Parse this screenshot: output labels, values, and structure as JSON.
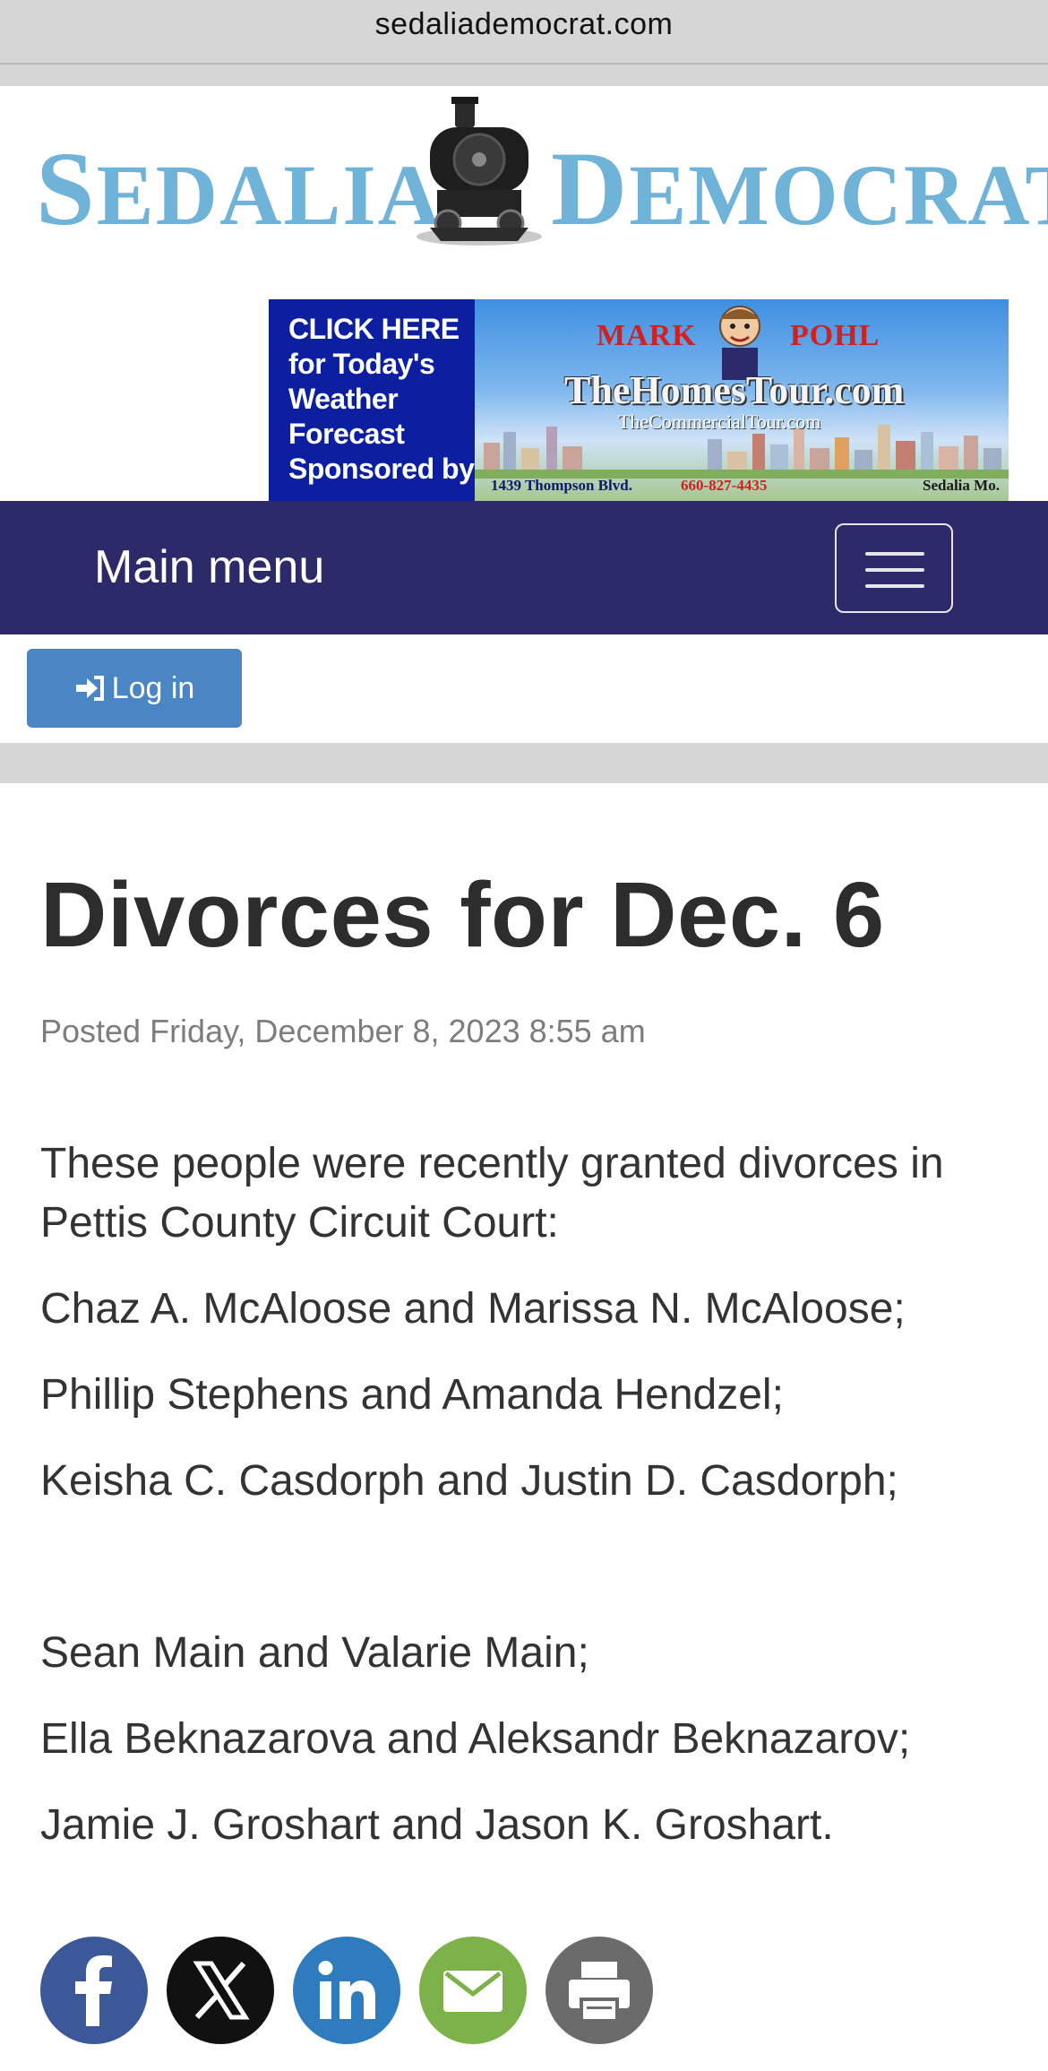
{
  "browser": {
    "url": "sedaliademocrat.com"
  },
  "masthead": {
    "logo_left": "Sedalia",
    "logo_right": "Democrat"
  },
  "ad": {
    "left_lines": [
      "CLICK HERE",
      "for Today's",
      "Weather",
      "Forecast",
      "Sponsored by"
    ],
    "name_first": "MARK",
    "name_last": "POHL",
    "site": "TheHomesTour.com",
    "sub_site": "TheCommercialTour.com",
    "address": "1439 Thompson Blvd.",
    "phone": "660-827-4435",
    "city": "Sedalia Mo."
  },
  "nav": {
    "title": "Main menu",
    "toggle_icon": "hamburger-icon"
  },
  "login": {
    "label": "Log in",
    "icon": "sign-in-icon"
  },
  "article": {
    "headline": "Divorces for Dec. 6",
    "posted": "Posted Friday, December 8, 2023 8:55 am",
    "intro": "These people were recently granted divorces in Pettis County Circuit Court:",
    "entries": [
      "Chaz A. McAloose and Marissa N. McAloose;",
      "Phillip Stephens and Amanda Hendzel;",
      "Keisha C. Casdorph and Justin D. Casdorph;",
      "Sean Main and Valarie Main;",
      "Ella Beknazarova and Aleksandr Beknazarov;",
      "Jamie J. Groshart and Jason K. Groshart."
    ]
  },
  "share": [
    {
      "name": "facebook-share",
      "icon": "facebook-icon",
      "color": "#3b5998"
    },
    {
      "name": "x-share",
      "icon": "x-icon",
      "color": "#111111"
    },
    {
      "name": "linkedin-share",
      "icon": "linkedin-icon",
      "color": "#2e7bbd"
    },
    {
      "name": "email-share",
      "icon": "email-icon",
      "color": "#7db24a"
    },
    {
      "name": "print-share",
      "icon": "printer-icon",
      "color": "#6b6b6b"
    }
  ],
  "colors": {
    "nav_bg": "#2c2a68",
    "login_bg": "#4a86c4",
    "logo": "#6fb3d9"
  }
}
